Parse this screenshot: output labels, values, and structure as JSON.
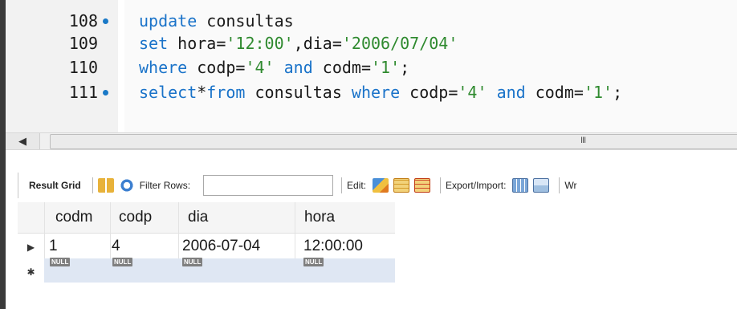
{
  "editor": {
    "lines": [
      {
        "num": "108",
        "dot": true,
        "tokens": [
          {
            "t": "update",
            "k": "kw"
          },
          {
            "t": " consultas",
            "k": ""
          }
        ]
      },
      {
        "num": "109",
        "dot": false,
        "tokens": [
          {
            "t": "set",
            "k": "kw"
          },
          {
            "t": " hora=",
            "k": ""
          },
          {
            "t": "'12:00'",
            "k": "str"
          },
          {
            "t": ",dia=",
            "k": ""
          },
          {
            "t": "'2006/07/04'",
            "k": "str"
          }
        ]
      },
      {
        "num": "110",
        "dot": false,
        "tokens": [
          {
            "t": "where",
            "k": "kw"
          },
          {
            "t": " codp=",
            "k": ""
          },
          {
            "t": "'4'",
            "k": "str"
          },
          {
            "t": " ",
            "k": ""
          },
          {
            "t": "and",
            "k": "kw"
          },
          {
            "t": " codm=",
            "k": ""
          },
          {
            "t": "'1'",
            "k": "str"
          },
          {
            "t": ";",
            "k": ""
          }
        ]
      },
      {
        "num": "111",
        "dot": true,
        "tokens": [
          {
            "t": "select",
            "k": "kw"
          },
          {
            "t": "*",
            "k": ""
          },
          {
            "t": "from",
            "k": "kw"
          },
          {
            "t": " consultas ",
            "k": ""
          },
          {
            "t": "where",
            "k": "kw"
          },
          {
            "t": " codp=",
            "k": ""
          },
          {
            "t": "'4'",
            "k": "str"
          },
          {
            "t": " ",
            "k": ""
          },
          {
            "t": "and",
            "k": "kw"
          },
          {
            "t": " codm=",
            "k": ""
          },
          {
            "t": "'1'",
            "k": "str"
          },
          {
            "t": ";",
            "k": ""
          }
        ]
      }
    ]
  },
  "scrollbar": {
    "left_arrow": "◀",
    "grip": "III"
  },
  "toolbar": {
    "result_grid": "Result Grid",
    "filter_rows": "Filter Rows:",
    "filter_value": "",
    "edit": "Edit:",
    "export_import": "Export/Import:",
    "wrap": "Wr"
  },
  "grid": {
    "columns": [
      "codm",
      "codp",
      "dia",
      "hora"
    ],
    "rows": [
      [
        "1",
        "4",
        "2006-07-04",
        "12:00:00"
      ]
    ],
    "null_label": "NULL",
    "row_marker": "▶",
    "new_row_marker": "✱"
  },
  "colors": {
    "keyword": "#1a73c9",
    "string": "#2f8a2f",
    "null_row": "#dfe7f3"
  }
}
